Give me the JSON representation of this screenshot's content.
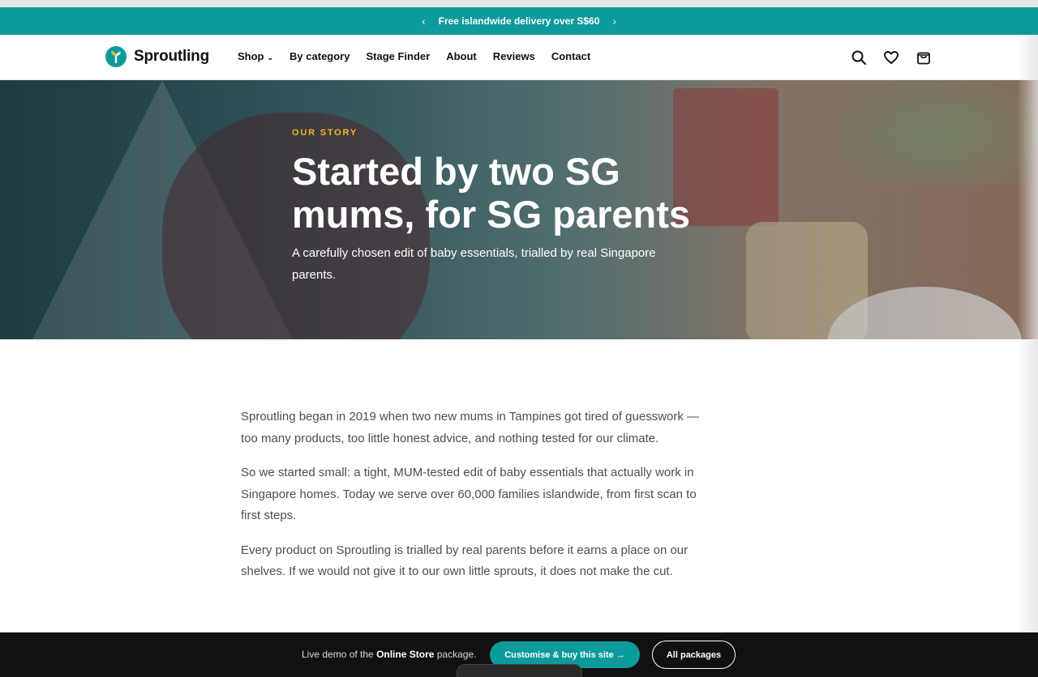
{
  "announcement": {
    "prev_icon": "chevron-left-icon",
    "text": "Free islandwide delivery over S$60",
    "next_icon": "chevron-right-icon"
  },
  "header": {
    "logo_text": "Sproutling",
    "nav": [
      {
        "label": "Shop",
        "has_dropdown": true
      },
      {
        "label": "By category"
      },
      {
        "label": "Stage Finder"
      },
      {
        "label": "About"
      },
      {
        "label": "Reviews"
      },
      {
        "label": "Contact"
      }
    ],
    "icons": [
      "search-icon",
      "heart-icon",
      "bag-icon"
    ]
  },
  "hero": {
    "eyebrow": "OUR STORY",
    "title": "Started by two SG mums, for SG parents",
    "subtitle": "A carefully chosen edit of baby essentials, trialled by real Singapore parents."
  },
  "story": {
    "paragraphs": [
      "Sproutling began in 2019 when two new mums in Tampines got tired of guesswork — too many products, too little honest advice, and nothing tested for our climate.",
      "So we started small: a tight, MUM-tested edit of baby essentials that actually work in Singapore homes. Today we serve over 60,000 families islandwide, from first scan to first steps.",
      "Every product on Sproutling is trialled by real parents before it earns a place on our shelves. If we would not give it to our own little sprouts, it does not make the cut."
    ]
  },
  "demo_bar": {
    "text_prefix": "Live demo of the ",
    "package_name": "Online Store",
    "text_suffix": " package.",
    "buy_label": "Customise & buy this site →",
    "all_label": "All packages"
  },
  "colors": {
    "brand_teal": "#0d9a9c",
    "eyebrow_gold": "#f1b52b",
    "demo_bar_bg": "#111111"
  }
}
